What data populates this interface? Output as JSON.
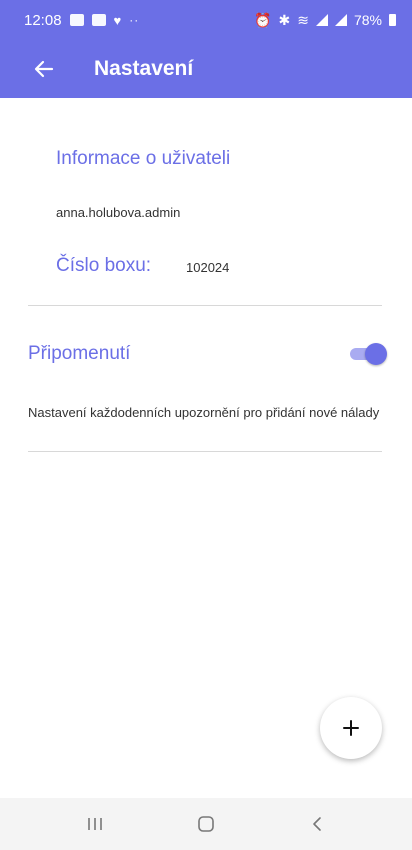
{
  "status_bar": {
    "time": "12:08",
    "battery": "78%",
    "icons": [
      "gallery-icon",
      "image-icon",
      "heart-icon",
      "more-dots-icon",
      "alarm-icon",
      "bluetooth-icon",
      "wifi-icon",
      "signal-icon",
      "battery-icon"
    ]
  },
  "app_bar": {
    "title": "Nastavení",
    "background_color": "#6b6fe6",
    "back_icon": "arrow-left-icon"
  },
  "user_info": {
    "heading": "Informace o uživateli",
    "username": "anna.holubova.admin",
    "box_label": "Číslo boxu:",
    "box_value": "102024"
  },
  "reminder": {
    "heading": "Připomenutí",
    "enabled": true,
    "description": "Nastavení každodenních upozornění pro přidání nové nálady"
  },
  "fab": {
    "icon": "plus-icon"
  },
  "nav_bar": {
    "icons": [
      "recent-apps-icon",
      "home-icon",
      "back-icon"
    ]
  },
  "colors": {
    "accent": "#6b6fe6",
    "accent_light": "#a9abf1",
    "text": "#333333"
  }
}
